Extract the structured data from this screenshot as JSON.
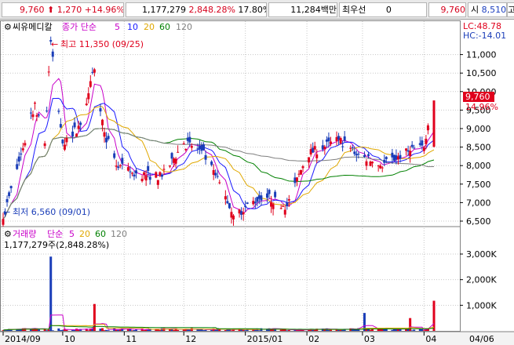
{
  "header": {
    "price": "9,760",
    "change": "1,270",
    "change_pct": "+14.96%",
    "volume": "1,177,279",
    "volume_ratio": "2,848.28%",
    "turnover": "17.80%",
    "amount": "11,284백만",
    "pref_label": "최우선",
    "pref_value": "0",
    "ask": "9,760",
    "open_label": "시",
    "open": "8,510",
    "high_label": "고",
    "high_partial": "9"
  },
  "price_panel": {
    "stock_name": "씨유메디칼",
    "ma_label": "종가 단순",
    "ma_periods": [
      "5",
      "10",
      "20",
      "60",
      "120"
    ],
    "lc": "LC:48.78",
    "hc": "HC:-14.01",
    "price_tag": "9,760",
    "pct_tag": "14.96%",
    "high_annotation": "최고 11,350 (09/25)",
    "low_annotation": "최저 6,560 (09/01)",
    "y_ticks": [
      "11,000",
      "10,500",
      "10,000",
      "9,500",
      "9,000",
      "8,500",
      "8,000",
      "7,500",
      "7,000",
      "6,500"
    ]
  },
  "volume_panel": {
    "title": "거래량",
    "ma_label": "단순",
    "ma_periods": [
      "5",
      "20",
      "60",
      "120"
    ],
    "value_text": "1,177,279주(2,848.28%)",
    "y_ticks": [
      "3,000K",
      "2,000K",
      "1,000K"
    ]
  },
  "x_axis": {
    "ticks": [
      "2014/09",
      "10",
      "11",
      "12",
      "2015/01",
      "02",
      "03",
      "04",
      "04/06"
    ]
  },
  "colors": {
    "up": "#e0001c",
    "down": "#1a3db8",
    "ma5": "#c800c8",
    "ma10": "#1a1aff",
    "ma20": "#e0a800",
    "ma60": "#008000",
    "ma120": "#7f7f7f",
    "grid": "#c8c8c8"
  },
  "chart_data": {
    "type": "candlestick",
    "x_start": "2014-09-01",
    "x_end": "2015-04-06",
    "ylim": [
      6500,
      11500
    ],
    "volume_ylim": [
      0,
      3000
    ],
    "volume_unit": "K",
    "series_price_anchor": [
      [
        "2014-09-01",
        6560
      ],
      [
        "2014-09-10",
        8300
      ],
      [
        "2014-09-17",
        9700
      ],
      [
        "2014-09-22",
        8600
      ],
      [
        "2014-09-25",
        11350
      ],
      [
        "2014-10-01",
        8600
      ],
      [
        "2014-10-10",
        9100
      ],
      [
        "2014-10-17",
        10600
      ],
      [
        "2014-10-22",
        8900
      ],
      [
        "2014-10-28",
        8000
      ],
      [
        "2014-11-05",
        7800
      ],
      [
        "2014-11-20",
        7700
      ],
      [
        "2014-12-01",
        8600
      ],
      [
        "2014-12-10",
        8400
      ],
      [
        "2014-12-20",
        7400
      ],
      [
        "2014-12-26",
        6650
      ],
      [
        "2015-01-10",
        7200
      ],
      [
        "2015-01-22",
        6900
      ],
      [
        "2015-02-01",
        8300
      ],
      [
        "2015-02-17",
        8700
      ],
      [
        "2015-02-27",
        8300
      ],
      [
        "2015-03-10",
        8000
      ],
      [
        "2015-03-25",
        8400
      ],
      [
        "2015-04-01",
        8490
      ],
      [
        "2015-04-06",
        9760
      ]
    ],
    "volume_spikes_k": [
      [
        "2014-09-25",
        2900
      ],
      [
        "2014-10-17",
        1050
      ],
      [
        "2015-03-02",
        700
      ],
      [
        "2015-03-25",
        500
      ],
      [
        "2015-04-06",
        1177
      ]
    ]
  }
}
